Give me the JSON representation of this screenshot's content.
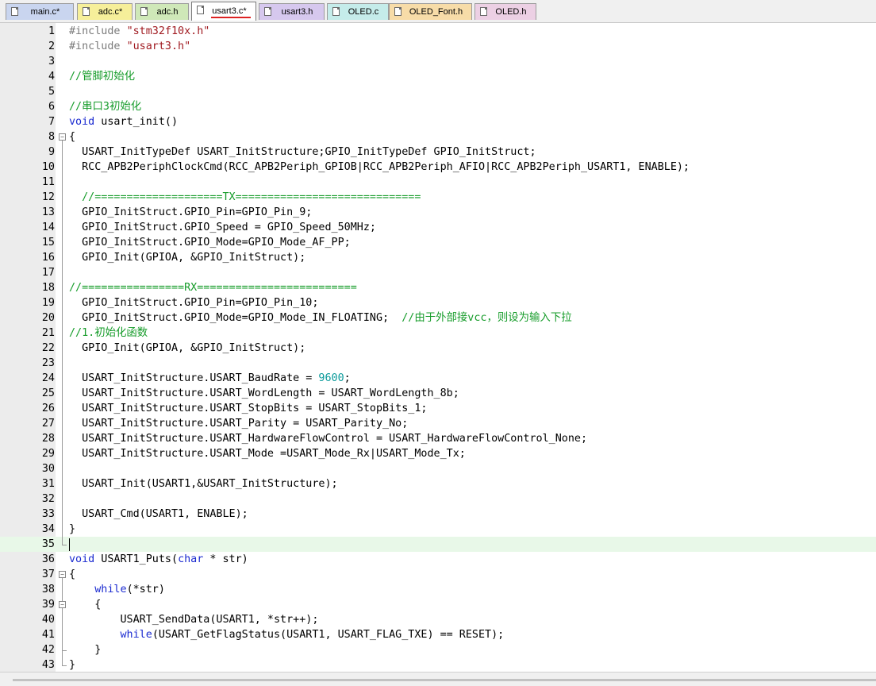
{
  "tabs": [
    {
      "label": "main.c*",
      "active": false,
      "color": "#c9d5ef"
    },
    {
      "label": "adc.c*",
      "active": false,
      "color": "#f6ef9a"
    },
    {
      "label": "adc.h",
      "active": false,
      "color": "#cfe8b8"
    },
    {
      "label": "usart3.c*",
      "active": true,
      "color": "#ffffff"
    },
    {
      "label": "usart3.h",
      "active": false,
      "color": "#d6c8ee"
    },
    {
      "label": "OLED.c",
      "active": false,
      "color": "#c5ecea"
    },
    {
      "label": "OLED_Font.h",
      "active": false,
      "color": "#f7dca8"
    },
    {
      "label": "OLED.h",
      "active": false,
      "color": "#ecd0e4"
    }
  ],
  "editor": {
    "current_line": 35,
    "lines": [
      [
        [
          "pp",
          "#include "
        ],
        [
          "str",
          "\"stm32f10x.h\""
        ]
      ],
      [
        [
          "pp",
          "#include "
        ],
        [
          "str",
          "\"usart3.h\""
        ]
      ],
      [],
      [
        [
          "cm",
          "//管脚初始化"
        ]
      ],
      [],
      [
        [
          "cm",
          "//串口3初始化"
        ]
      ],
      [
        [
          "kw",
          "void"
        ],
        [
          "n",
          " usart_init()"
        ]
      ],
      [
        [
          "n",
          "{"
        ]
      ],
      [
        [
          "n",
          "  USART_InitTypeDef USART_InitStructure;GPIO_InitTypeDef GPIO_InitStruct;"
        ]
      ],
      [
        [
          "n",
          "  RCC_APB2PeriphClockCmd(RCC_APB2Periph_GPIOB|RCC_APB2Periph_AFIO|RCC_APB2Periph_USART1, ENABLE);"
        ]
      ],
      [],
      [
        [
          "n",
          "  "
        ],
        [
          "cm",
          "//====================TX============================="
        ]
      ],
      [
        [
          "n",
          "  GPIO_InitStruct.GPIO_Pin=GPIO_Pin_9;"
        ]
      ],
      [
        [
          "n",
          "  GPIO_InitStruct.GPIO_Speed = GPIO_Speed_50MHz;"
        ]
      ],
      [
        [
          "n",
          "  GPIO_InitStruct.GPIO_Mode=GPIO_Mode_AF_PP;"
        ]
      ],
      [
        [
          "n",
          "  GPIO_Init(GPIOA, &GPIO_InitStruct);"
        ]
      ],
      [],
      [
        [
          "cm",
          "//================RX========================="
        ]
      ],
      [
        [
          "n",
          "  GPIO_InitStruct.GPIO_Pin=GPIO_Pin_10;"
        ]
      ],
      [
        [
          "n",
          "  GPIO_InitStruct.GPIO_Mode=GPIO_Mode_IN_FLOATING;  "
        ],
        [
          "cm",
          "//由于外部接vcc，则设为输入下拉"
        ]
      ],
      [
        [
          "cm",
          "//1.初始化函数"
        ]
      ],
      [
        [
          "n",
          "  GPIO_Init(GPIOA, &GPIO_InitStruct);"
        ]
      ],
      [],
      [
        [
          "n",
          "  USART_InitStructure.USART_BaudRate = "
        ],
        [
          "num",
          "9600"
        ],
        [
          "n",
          ";"
        ]
      ],
      [
        [
          "n",
          "  USART_InitStructure.USART_WordLength = USART_WordLength_8b;"
        ]
      ],
      [
        [
          "n",
          "  USART_InitStructure.USART_StopBits = USART_StopBits_1;"
        ]
      ],
      [
        [
          "n",
          "  USART_InitStructure.USART_Parity = USART_Parity_No;"
        ]
      ],
      [
        [
          "n",
          "  USART_InitStructure.USART_HardwareFlowControl = USART_HardwareFlowControl_None;"
        ]
      ],
      [
        [
          "n",
          "  USART_InitStructure.USART_Mode =USART_Mode_Rx|USART_Mode_Tx;"
        ]
      ],
      [],
      [
        [
          "n",
          "  USART_Init(USART1,&USART_InitStructure);"
        ]
      ],
      [],
      [
        [
          "n",
          "  USART_Cmd(USART1, ENABLE);"
        ]
      ],
      [
        [
          "n",
          "}"
        ]
      ],
      [],
      [
        [
          "kw",
          "void"
        ],
        [
          "n",
          " USART1_Puts("
        ],
        [
          "kw",
          "char"
        ],
        [
          "n",
          " * str)"
        ]
      ],
      [
        [
          "n",
          "{"
        ]
      ],
      [
        [
          "n",
          "    "
        ],
        [
          "kw",
          "while"
        ],
        [
          "n",
          "(*str)"
        ]
      ],
      [
        [
          "n",
          "    {"
        ]
      ],
      [
        [
          "n",
          "        USART_SendData(USART1, *str++);"
        ]
      ],
      [
        [
          "n",
          "        "
        ],
        [
          "kw",
          "while"
        ],
        [
          "n",
          "(USART_GetFlagStatus(USART1, USART_FLAG_TXE) == RESET);"
        ]
      ],
      [
        [
          "n",
          "    }"
        ]
      ],
      [
        [
          "n",
          "}"
        ]
      ]
    ],
    "folds": [
      {
        "start": 8,
        "end": 35
      },
      {
        "start": 37,
        "end": 43
      },
      {
        "start": 39,
        "end": 42
      }
    ]
  }
}
